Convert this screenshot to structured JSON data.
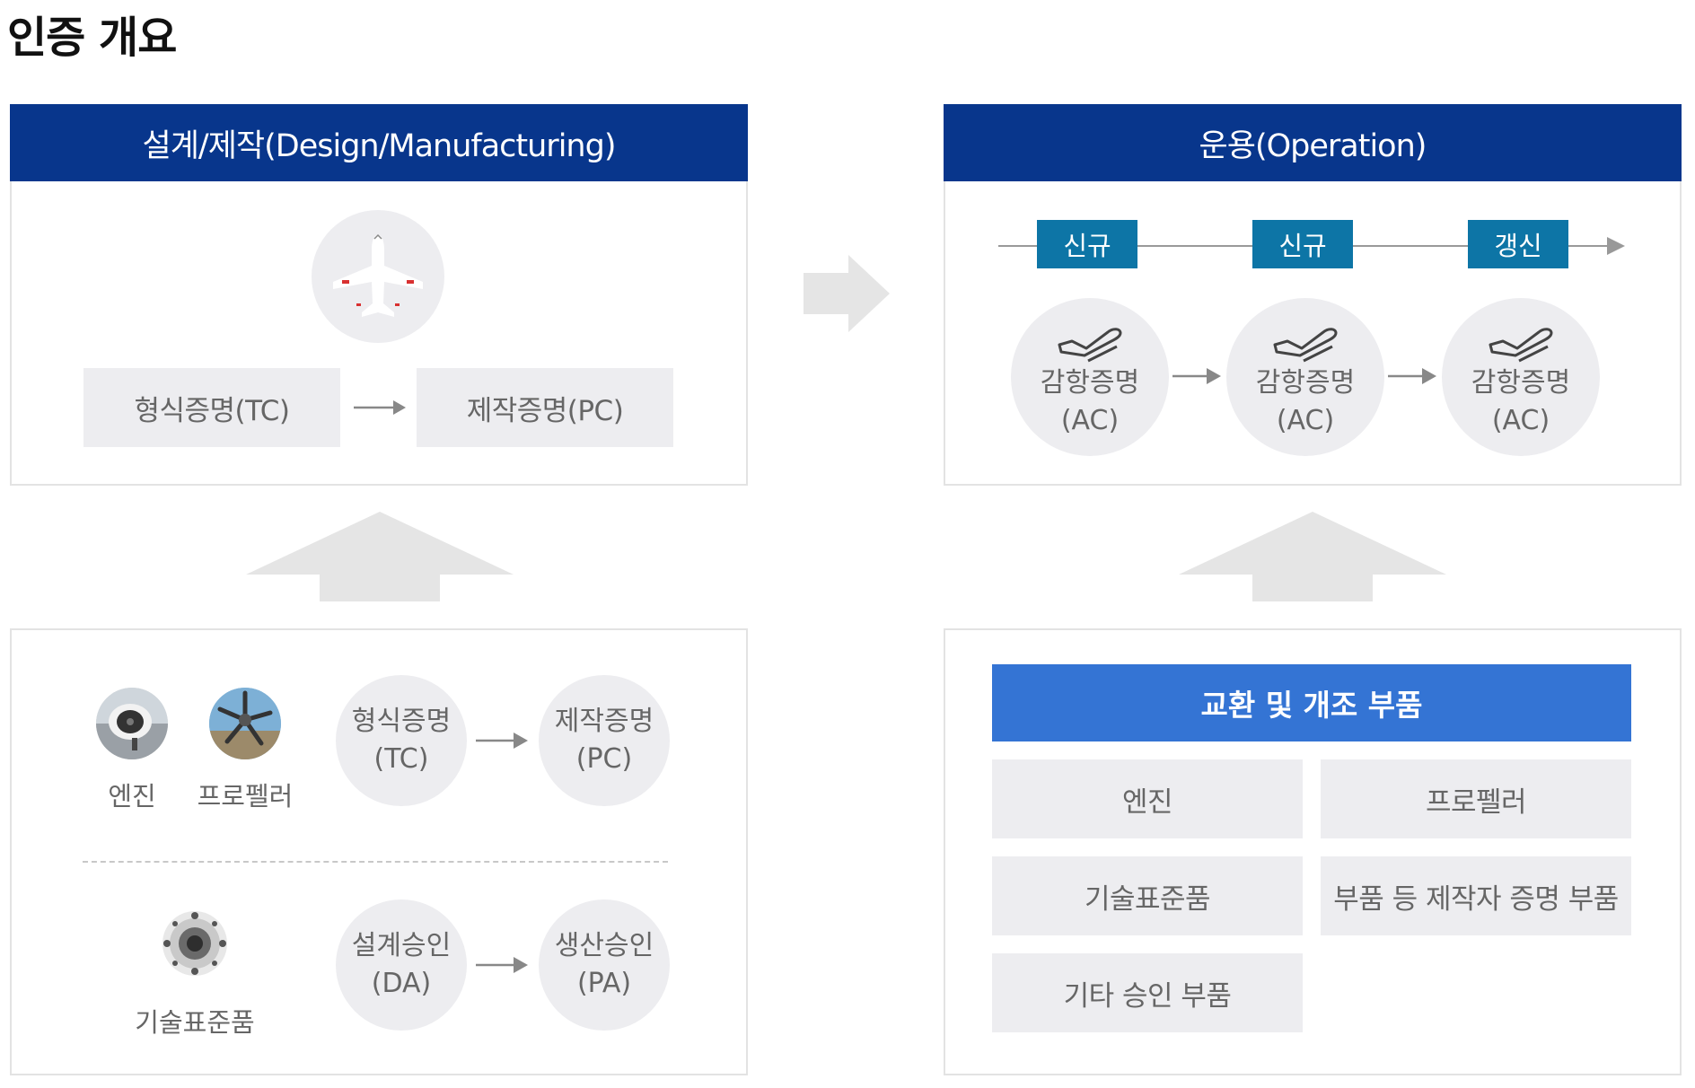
{
  "title": "인증 개요",
  "design_panel": {
    "header": "설계/제작(Design/Manufacturing)",
    "tc_label": "형식증명(TC)",
    "pc_label": "제작증명(PC)"
  },
  "operation_panel": {
    "header": "운용(Operation)",
    "tags": [
      "신규",
      "신규",
      "갱신"
    ],
    "ac_circles": [
      {
        "line1": "감항증명",
        "line2": "(AC)"
      },
      {
        "line1": "감항증명",
        "line2": "(AC)"
      },
      {
        "line1": "감항증명",
        "line2": "(AC)"
      }
    ]
  },
  "components_panel": {
    "engine_label": "엔진",
    "propeller_label": "프로펠러",
    "tso_label": "기술표준품",
    "tc_circle": {
      "line1": "형식증명",
      "line2": "(TC)"
    },
    "pc_circle": {
      "line1": "제작증명",
      "line2": "(PC)"
    },
    "da_circle": {
      "line1": "설계승인",
      "line2": "(DA)"
    },
    "pa_circle": {
      "line1": "생산승인",
      "line2": "(PA)"
    }
  },
  "parts_panel": {
    "header": "교환 및 개조 부품",
    "items": [
      "엔진",
      "프로펠러",
      "기술표준품",
      "부품 등 제작자 증명 부품",
      "기타 승인 부품"
    ]
  },
  "colors": {
    "navy_header": "#08368c",
    "teal_tag": "#0d75a6",
    "blue_bar": "#3474d4",
    "gray_fill": "#ededf0",
    "arrow_gray": "#e5e5e5"
  },
  "icons": [
    "airplane-icon",
    "takeoff-icon",
    "engine-photo",
    "propeller-photo",
    "tso-part-photo"
  ]
}
